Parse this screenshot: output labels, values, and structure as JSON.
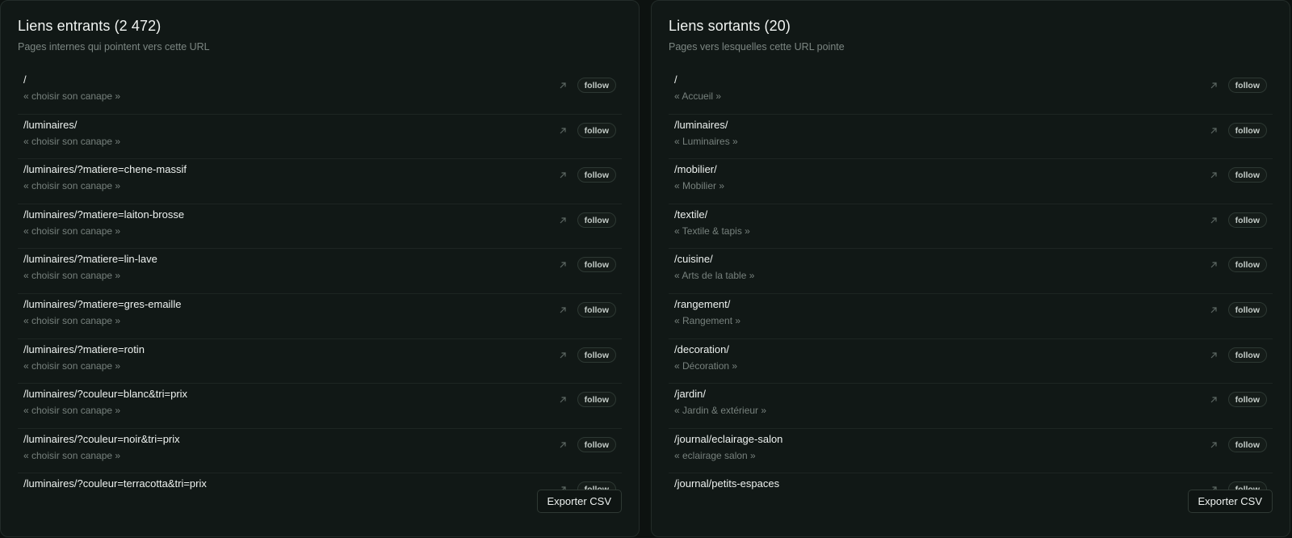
{
  "inbound": {
    "title": "Liens entrants (2 472)",
    "subtitle": "Pages internes qui pointent vers cette URL",
    "rows": [
      {
        "url": "/",
        "anchor": "« choisir son canape »",
        "rel": "follow"
      },
      {
        "url": "/luminaires/",
        "anchor": "« choisir son canape »",
        "rel": "follow"
      },
      {
        "url": "/luminaires/?matiere=chene-massif",
        "anchor": "« choisir son canape »",
        "rel": "follow"
      },
      {
        "url": "/luminaires/?matiere=laiton-brosse",
        "anchor": "« choisir son canape »",
        "rel": "follow"
      },
      {
        "url": "/luminaires/?matiere=lin-lave",
        "anchor": "« choisir son canape »",
        "rel": "follow"
      },
      {
        "url": "/luminaires/?matiere=gres-emaille",
        "anchor": "« choisir son canape »",
        "rel": "follow"
      },
      {
        "url": "/luminaires/?matiere=rotin",
        "anchor": "« choisir son canape »",
        "rel": "follow"
      },
      {
        "url": "/luminaires/?couleur=blanc&tri=prix",
        "anchor": "« choisir son canape »",
        "rel": "follow"
      },
      {
        "url": "/luminaires/?couleur=noir&tri=prix",
        "anchor": "« choisir son canape »",
        "rel": "follow"
      },
      {
        "url": "/luminaires/?couleur=terracotta&tri=prix",
        "anchor": "",
        "rel": "follow"
      }
    ],
    "export_label": "Exporter CSV"
  },
  "outbound": {
    "title": "Liens sortants (20)",
    "subtitle": "Pages vers lesquelles cette URL pointe",
    "rows": [
      {
        "url": "/",
        "anchor": "« Accueil »",
        "rel": "follow"
      },
      {
        "url": "/luminaires/",
        "anchor": "« Luminaires »",
        "rel": "follow"
      },
      {
        "url": "/mobilier/",
        "anchor": "« Mobilier »",
        "rel": "follow"
      },
      {
        "url": "/textile/",
        "anchor": "« Textile & tapis »",
        "rel": "follow"
      },
      {
        "url": "/cuisine/",
        "anchor": "« Arts de la table »",
        "rel": "follow"
      },
      {
        "url": "/rangement/",
        "anchor": "« Rangement »",
        "rel": "follow"
      },
      {
        "url": "/decoration/",
        "anchor": "« Décoration »",
        "rel": "follow"
      },
      {
        "url": "/jardin/",
        "anchor": "« Jardin & extérieur »",
        "rel": "follow"
      },
      {
        "url": "/journal/eclairage-salon",
        "anchor": "« eclairage salon »",
        "rel": "follow"
      },
      {
        "url": "/journal/petits-espaces",
        "anchor": "",
        "rel": "follow"
      }
    ],
    "export_label": "Exporter CSV"
  },
  "icons": {
    "row_link": "external-link-arrow-icon"
  },
  "colors": {
    "background": "#0d1210",
    "panel": "#111816",
    "muted_text": "#77817d"
  }
}
